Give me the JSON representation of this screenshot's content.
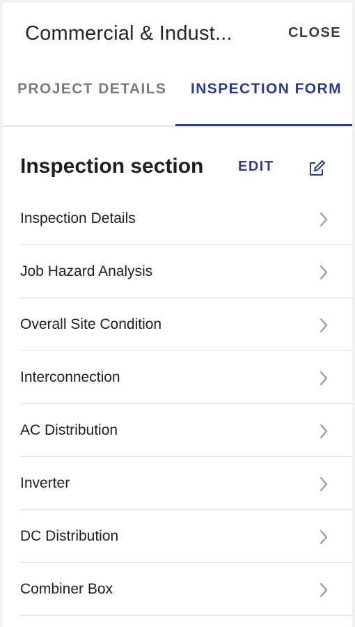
{
  "header": {
    "title": "Commercial & Indust...",
    "close_label": "CLOSE"
  },
  "tabs": [
    {
      "label": "PROJECT DETAILS",
      "active": false
    },
    {
      "label": "INSPECTION FORM",
      "active": true
    }
  ],
  "section": {
    "title": "Inspection section",
    "edit_label": "EDIT",
    "edit_icon": "edit-square-icon"
  },
  "items": [
    {
      "label": "Inspection Details",
      "icon": "chevron-right-icon"
    },
    {
      "label": "Job Hazard Analysis",
      "icon": "chevron-right-icon"
    },
    {
      "label": "Overall Site Condition",
      "icon": "chevron-right-icon"
    },
    {
      "label": "Interconnection",
      "icon": "chevron-right-icon"
    },
    {
      "label": "AC Distribution",
      "icon": "chevron-right-icon"
    },
    {
      "label": "Inverter",
      "icon": "chevron-right-icon"
    },
    {
      "label": "DC Distribution",
      "icon": "chevron-right-icon"
    },
    {
      "label": "Combiner Box",
      "icon": "chevron-right-icon"
    }
  ],
  "colors": {
    "accent": "#2d3b8a",
    "divider": "#dcdcdf",
    "inactive_tab": "#7c7c7c"
  }
}
